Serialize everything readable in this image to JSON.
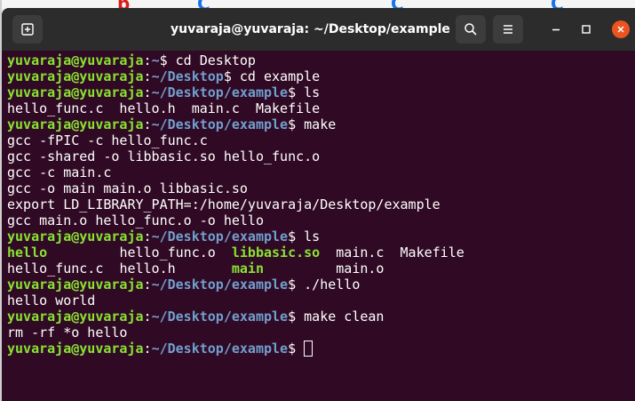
{
  "window": {
    "title": "yuvaraja@yuvaraja: ~/Desktop/example",
    "icons": {
      "new_tab": "new-tab-icon",
      "search": "search-icon",
      "menu": "hamburger-menu-icon",
      "minimize": "minimize-icon",
      "maximize": "maximize-icon",
      "close": "close-icon"
    }
  },
  "colors": {
    "terminal_bg": "#300a24",
    "titlebar_bg": "#2c2c2c",
    "user_host": "#8ae234",
    "path": "#729fcf",
    "text": "#ffffff",
    "close_button": "#e95420"
  },
  "terminal": {
    "prompt_user": "yuvaraja@yuvaraja",
    "lines": [
      {
        "type": "prompt",
        "path": "~",
        "cmd": "cd Desktop"
      },
      {
        "type": "prompt",
        "path": "~/Desktop",
        "cmd": "cd example"
      },
      {
        "type": "prompt",
        "path": "~/Desktop/example",
        "cmd": "ls"
      },
      {
        "type": "output",
        "text": "hello_func.c  hello.h  main.c  Makefile"
      },
      {
        "type": "prompt",
        "path": "~/Desktop/example",
        "cmd": "make"
      },
      {
        "type": "output",
        "text": "gcc -fPIC -c hello_func.c"
      },
      {
        "type": "output",
        "text": "gcc -shared -o libbasic.so hello_func.o"
      },
      {
        "type": "output",
        "text": "gcc -c main.c"
      },
      {
        "type": "output",
        "text": "gcc -o main main.o libbasic.so"
      },
      {
        "type": "output",
        "text": "export LD_LIBRARY_PATH=:/home/yuvaraja/Desktop/example"
      },
      {
        "type": "output",
        "text": "gcc main.o hello_func.o -o hello"
      },
      {
        "type": "prompt",
        "path": "~/Desktop/example",
        "cmd": "ls"
      },
      {
        "type": "ls",
        "cells": [
          {
            "text": "hello",
            "exec": true
          },
          {
            "text": "hello_func.o",
            "exec": false
          },
          {
            "text": "libbasic.so",
            "exec": true
          },
          {
            "text": "main.c",
            "exec": false
          },
          {
            "text": "Makefile",
            "exec": false
          }
        ]
      },
      {
        "type": "ls",
        "cells": [
          {
            "text": "hello_func.c",
            "exec": false
          },
          {
            "text": "hello.h",
            "exec": false
          },
          {
            "text": "main",
            "exec": true
          },
          {
            "text": "main.o",
            "exec": false
          }
        ]
      },
      {
        "type": "prompt",
        "path": "~/Desktop/example",
        "cmd": "./hello"
      },
      {
        "type": "output",
        "text": "hello world"
      },
      {
        "type": "prompt",
        "path": "~/Desktop/example",
        "cmd": "make clean"
      },
      {
        "type": "output",
        "text": "rm -rf *o hello"
      },
      {
        "type": "prompt",
        "path": "~/Desktop/example",
        "cmd": "",
        "cursor": true
      }
    ]
  }
}
